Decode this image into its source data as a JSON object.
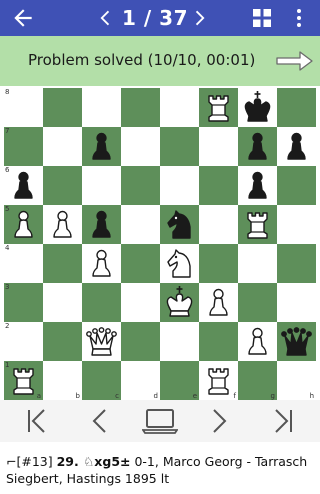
{
  "header": {
    "counter": "1 / 37",
    "icons": {
      "back": "arrow-left-icon",
      "prev": "chevron-left-icon",
      "next": "chevron-right-icon",
      "grid": "grid-icon",
      "menu": "more-vert-icon"
    }
  },
  "status": {
    "text": "Problem solved (10/10, 00:01)",
    "icon": "arrow-right-icon"
  },
  "board": {
    "ranks": [
      "8",
      "7",
      "6",
      "5",
      "4",
      "3",
      "2",
      "1"
    ],
    "files": [
      "a",
      "b",
      "c",
      "d",
      "e",
      "f",
      "g",
      "h"
    ],
    "pieces": [
      {
        "square": "f8",
        "piece": "R",
        "color": "w",
        "name": "white-rook"
      },
      {
        "square": "g8",
        "piece": "K",
        "color": "b",
        "name": "black-king"
      },
      {
        "square": "c7",
        "piece": "P",
        "color": "b",
        "name": "black-pawn"
      },
      {
        "square": "g7",
        "piece": "P",
        "color": "b",
        "name": "black-pawn"
      },
      {
        "square": "h7",
        "piece": "P",
        "color": "b",
        "name": "black-pawn"
      },
      {
        "square": "g6",
        "piece": "P",
        "color": "b",
        "name": "black-pawn"
      },
      {
        "square": "a6",
        "piece": "P",
        "color": "b",
        "name": "black-pawn"
      },
      {
        "square": "a5",
        "piece": "P",
        "color": "w",
        "name": "white-pawn"
      },
      {
        "square": "b5",
        "piece": "P",
        "color": "w",
        "name": "white-pawn"
      },
      {
        "square": "c5",
        "piece": "P",
        "color": "b",
        "name": "black-pawn"
      },
      {
        "square": "e5",
        "piece": "N",
        "color": "b",
        "name": "black-knight"
      },
      {
        "square": "g5",
        "piece": "R",
        "color": "w",
        "name": "white-rook"
      },
      {
        "square": "c4",
        "piece": "P",
        "color": "w",
        "name": "white-pawn"
      },
      {
        "square": "e4",
        "piece": "N",
        "color": "w",
        "name": "white-knight"
      },
      {
        "square": "e3",
        "piece": "K",
        "color": "w",
        "name": "white-king"
      },
      {
        "square": "f3",
        "piece": "P",
        "color": "w",
        "name": "white-pawn"
      },
      {
        "square": "c2",
        "piece": "Q",
        "color": "w",
        "name": "white-queen"
      },
      {
        "square": "g2",
        "piece": "P",
        "color": "w",
        "name": "white-pawn"
      },
      {
        "square": "h2",
        "piece": "Q",
        "color": "b",
        "name": "black-queen"
      },
      {
        "square": "a1",
        "piece": "R",
        "color": "w",
        "name": "white-rook"
      },
      {
        "square": "f1",
        "piece": "R",
        "color": "w",
        "name": "white-rook"
      }
    ]
  },
  "navbar": {
    "icons": [
      "first-move-icon",
      "previous-move-icon",
      "laptop-icon",
      "next-move-icon",
      "last-move-icon"
    ]
  },
  "moveinfo": {
    "prefix": "⌐[#13] ",
    "move_number": "29.",
    "move": " ♘xg5±",
    "rest": " 0-1, Marco Georg - Tarrasch Siegbert, Hastings 1895 lt"
  },
  "colors": {
    "appbar": "#3f51b5",
    "status": "#b3dfa8",
    "light_square": "#ffffff",
    "dark_square": "#5e8f5a"
  }
}
